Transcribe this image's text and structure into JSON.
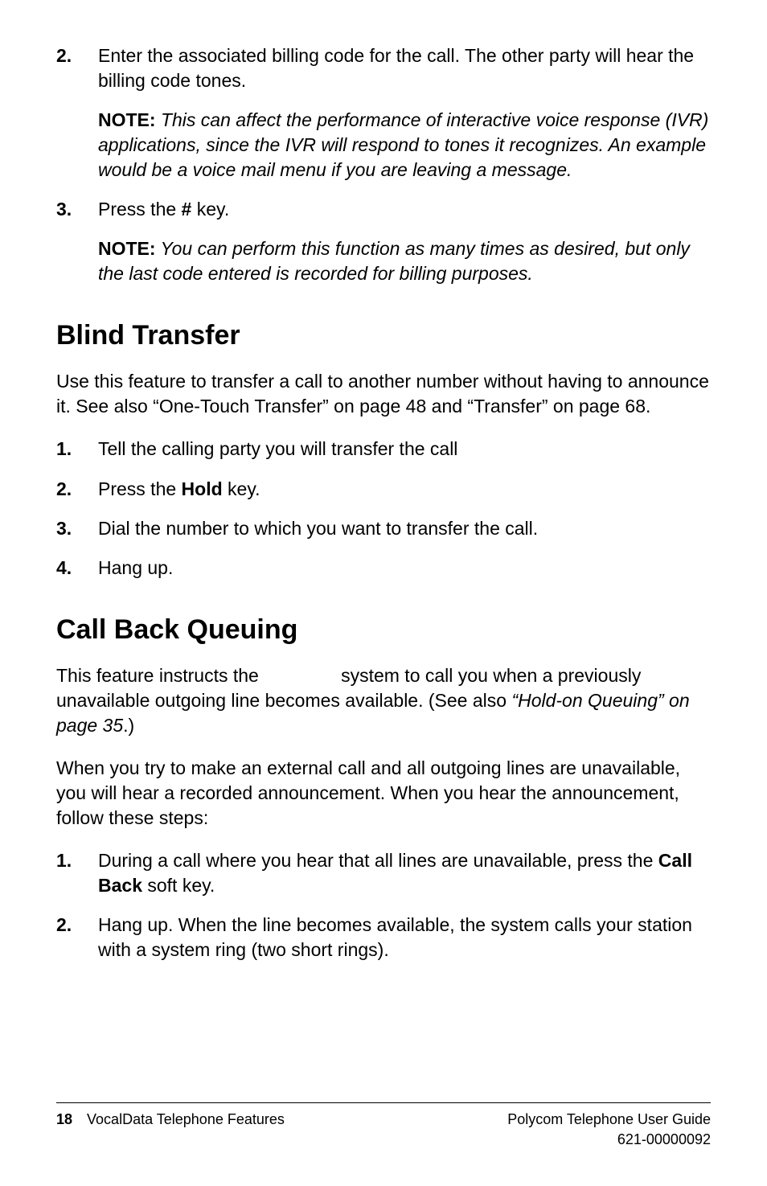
{
  "items_top": [
    {
      "num": "2.",
      "body": "Enter the associated billing code for the call. The other party will hear the billing code tones.",
      "note_label": "NOTE:",
      "note_body": " This can affect the performance of interactive voice response (IVR) applications, since the IVR will respond to tones it recognizes. An example would be a voice mail menu if you are leaving a message."
    },
    {
      "num": "3.",
      "body_pre": "Press the ",
      "body_bold": "#",
      "body_post": " key.",
      "note_label": "NOTE:",
      "note_body": " You can perform this function as many times as desired, but only the last code entered is recorded for billing purposes."
    }
  ],
  "blind": {
    "title": "Blind Transfer",
    "intro": "Use this feature to transfer a call to another number without having to announce it. See also “One-Touch Transfer” on page 48 and “Transfer” on page 68.",
    "steps": [
      {
        "num": "1.",
        "text": "Tell the calling party you will transfer the call"
      },
      {
        "num": "2.",
        "pre": "Press the ",
        "bold": "Hold",
        "post": " key."
      },
      {
        "num": "3.",
        "text": "Dial the number to which you want to transfer the call."
      },
      {
        "num": "4.",
        "text": "Hang up."
      }
    ]
  },
  "queuing": {
    "title": "Call Back Queuing",
    "intro_pre": "This feature instructs the                system to call you when a previously unavailable outgoing line becomes available. (See also ",
    "intro_italic": "“Hold-on Queuing” on page 35",
    "intro_post": ".)",
    "intro2": "When you try to make an external call and all outgoing lines are unavailable, you will hear a recorded announcement. When you hear the announcement, follow these steps:",
    "steps": [
      {
        "num": "1.",
        "pre": "During a call where you hear that all lines are unavailable, press the ",
        "bold": "Call Back",
        "post": " soft key."
      },
      {
        "num": "2.",
        "text": "Hang up. When the line becomes available, the system calls your station with a system ring (two short rings)."
      }
    ]
  },
  "footer": {
    "page": "18",
    "left": "VocalData Telephone Features",
    "right1": "Polycom Telephone User Guide",
    "right2": "621-00000092"
  }
}
